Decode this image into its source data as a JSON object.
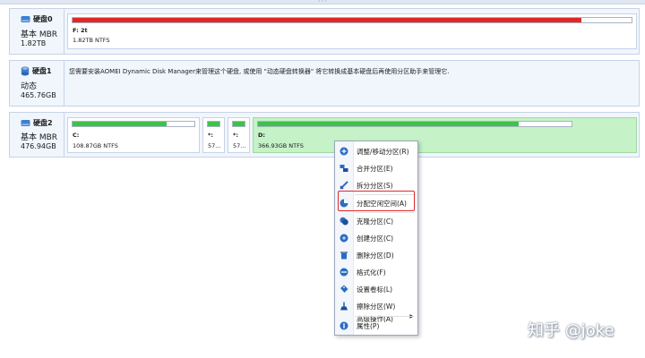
{
  "disks": [
    {
      "name": "硬盘0",
      "type": "基本 MBR",
      "size": "1.82TB",
      "partitions": [
        {
          "label": "F: 2t",
          "info": "1.82TB NTFS",
          "used_fraction": 0.91,
          "bar_color": "#e0282a"
        }
      ]
    },
    {
      "name": "硬盘1",
      "type": "动态",
      "size": "465.76GB",
      "message": "您需要安装AOMEI Dynamic Disk Manager来管理这个硬盘, 或使用 \"动态硬盘转换器\" 将它转换成基本硬盘后再使用分区助手来管理它."
    },
    {
      "name": "硬盘2",
      "type": "基本 MBR",
      "size": "476.94GB",
      "partitions": [
        {
          "label": "C:",
          "info": "108.87GB NTFS",
          "used_fraction": 0.77,
          "bar_color": "#3ec24a"
        },
        {
          "label": "*:",
          "info": "57...",
          "used_fraction": 1.0,
          "bar_color": "#3ec24a"
        },
        {
          "label": "*:",
          "info": "57...",
          "used_fraction": 1.0,
          "bar_color": "#3ec24a"
        },
        {
          "label": "D:",
          "info": "366.93GB NTFS",
          "used_fraction": 0.83,
          "bar_color": "#3ec24a",
          "selected": true
        }
      ]
    }
  ],
  "context_menu": {
    "items": [
      {
        "label": "调整/移动分区(R)",
        "icon": "resize-move-icon"
      },
      {
        "label": "合并分区(E)",
        "icon": "merge-icon"
      },
      {
        "label": "拆分分区(S)",
        "icon": "split-icon"
      },
      {
        "label": "分配空闲空间(A)",
        "icon": "allocate-space-icon",
        "highlighted": true
      },
      {
        "label": "克隆分区(C)",
        "icon": "clone-icon"
      },
      {
        "label": "创建分区(C)",
        "icon": "create-icon"
      },
      {
        "label": "删除分区(D)",
        "icon": "delete-icon"
      },
      {
        "label": "格式化(F)",
        "icon": "format-icon"
      },
      {
        "label": "设置卷标(L)",
        "icon": "label-icon"
      },
      {
        "label": "擦除分区(W)",
        "icon": "wipe-icon"
      },
      {
        "label": "高级操作(A)",
        "icon": "",
        "submenu": true
      },
      {
        "label": "属性(P)",
        "icon": "properties-icon"
      }
    ]
  },
  "watermark": "知乎 @joke",
  "colors": {
    "accent_red": "#e0282a",
    "used_green": "#3ec24a",
    "selected_bg": "#c6f2c8",
    "row_bg": "#f1f6fd"
  }
}
